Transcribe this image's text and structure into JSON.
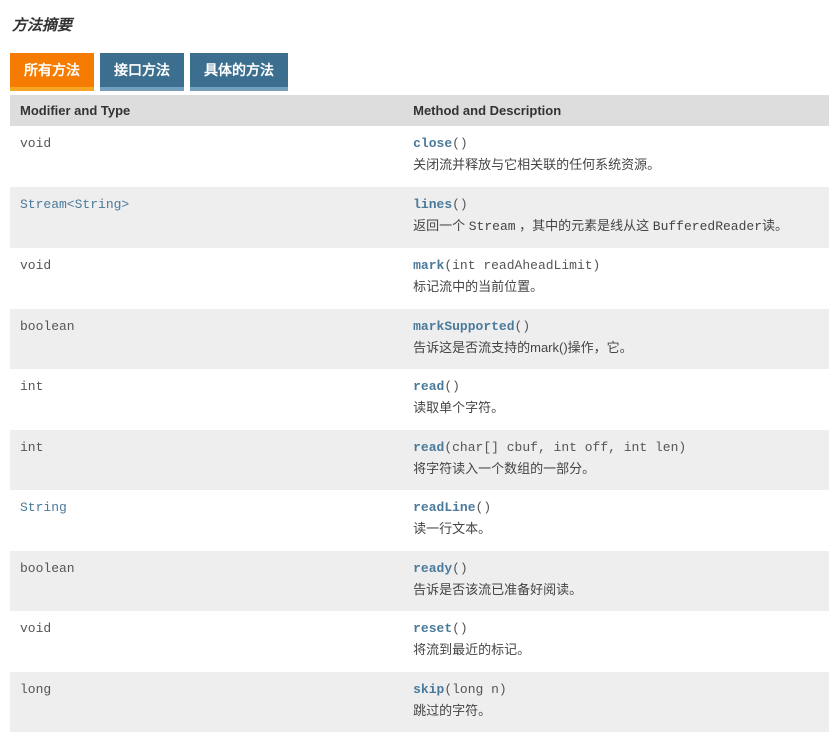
{
  "title": "方法摘要",
  "tabs": [
    {
      "label": "所有方法",
      "active": true
    },
    {
      "label": "接口方法",
      "active": false
    },
    {
      "label": "具体的方法",
      "active": false
    }
  ],
  "columns": {
    "modifier": "Modifier and Type",
    "method": "Method and Description"
  },
  "rows": [
    {
      "modifier_text": "void",
      "modifier_is_link": false,
      "method_name": "close",
      "params": "()",
      "desc_parts": [
        {
          "t": "关闭流并释放与它相关联的任何系统资源。",
          "code": false
        }
      ]
    },
    {
      "modifier_text": "Stream<String>",
      "modifier_is_link": true,
      "method_name": "lines",
      "params": "()",
      "desc_parts": [
        {
          "t": "返回一个 ",
          "code": false
        },
        {
          "t": "Stream",
          "code": true
        },
        {
          "t": " ，其中的元素是线从这 ",
          "code": false
        },
        {
          "t": "BufferedReader",
          "code": true
        },
        {
          "t": "读。",
          "code": false
        }
      ]
    },
    {
      "modifier_text": "void",
      "modifier_is_link": false,
      "method_name": "mark",
      "params": "(int readAheadLimit)",
      "desc_parts": [
        {
          "t": "标记流中的当前位置。",
          "code": false
        }
      ]
    },
    {
      "modifier_text": "boolean",
      "modifier_is_link": false,
      "method_name": "markSupported",
      "params": "()",
      "desc_parts": [
        {
          "t": "告诉这是否流支持的mark()操作，它。",
          "code": false
        }
      ]
    },
    {
      "modifier_text": "int",
      "modifier_is_link": false,
      "method_name": "read",
      "params": "()",
      "desc_parts": [
        {
          "t": "读取单个字符。",
          "code": false
        }
      ]
    },
    {
      "modifier_text": "int",
      "modifier_is_link": false,
      "method_name": "read",
      "params": "(char[] cbuf, int off, int len)",
      "desc_parts": [
        {
          "t": "将字符读入一个数组的一部分。",
          "code": false
        }
      ]
    },
    {
      "modifier_text": "String",
      "modifier_is_link": true,
      "method_name": "readLine",
      "params": "()",
      "desc_parts": [
        {
          "t": "读一行文本。",
          "code": false
        }
      ]
    },
    {
      "modifier_text": "boolean",
      "modifier_is_link": false,
      "method_name": "ready",
      "params": "()",
      "desc_parts": [
        {
          "t": "告诉是否该流已准备好阅读。",
          "code": false
        }
      ]
    },
    {
      "modifier_text": "void",
      "modifier_is_link": false,
      "method_name": "reset",
      "params": "()",
      "desc_parts": [
        {
          "t": "将流到最近的标记。",
          "code": false
        }
      ]
    },
    {
      "modifier_text": "long",
      "modifier_is_link": false,
      "method_name": "skip",
      "params": "(long n)",
      "desc_parts": [
        {
          "t": "跳过的字符。",
          "code": false
        }
      ]
    }
  ]
}
